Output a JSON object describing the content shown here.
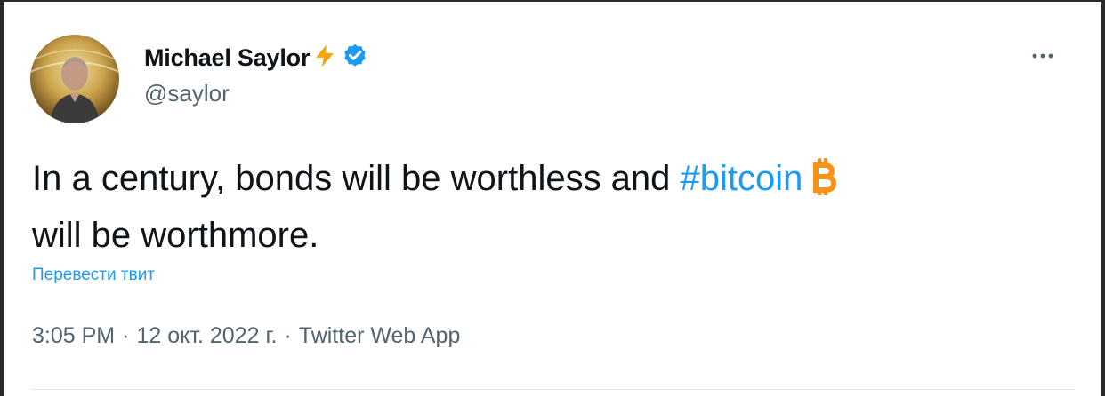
{
  "tweet": {
    "author": {
      "display_name": "Michael Saylor",
      "handle": "@saylor",
      "verified": true,
      "name_emoji": "lightning-icon"
    },
    "text": {
      "line1_before_hashtag": "In a century, bonds will be worthless and ",
      "hashtag": "#bitcoin",
      "line2": "will be worthmore."
    },
    "text_emoji": "bitcoin-icon",
    "translate_label": "Перевести твит",
    "meta": {
      "time": "3:05 PM",
      "separator": "·",
      "date": "12 окт. 2022 г.",
      "source": "Twitter Web App"
    }
  },
  "colors": {
    "accent": "#1d9bf0",
    "text": "#0f1419",
    "muted": "#536471",
    "lightning": "#f7a600",
    "bitcoin": "#f7931a"
  }
}
